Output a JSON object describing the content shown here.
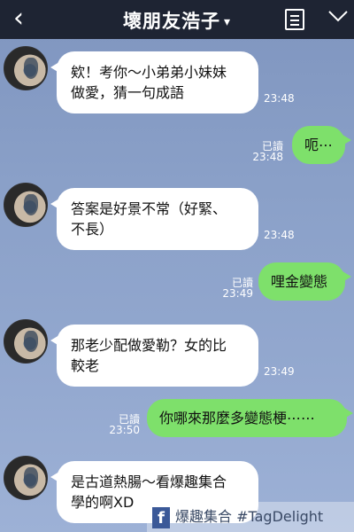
{
  "header": {
    "title": "壞朋友浩子",
    "caret": "▾",
    "back_icon": "back-chevron-icon",
    "menu_icon": "notes-menu-icon",
    "collapse_icon": "chevron-down-icon"
  },
  "messages": [
    {
      "side": "in",
      "lines": [
        "欸！考你～小弟弟小妹妹",
        "做愛，猜一句成語"
      ],
      "time": "23:48"
    },
    {
      "side": "out",
      "lines": [
        "呃⋯"
      ],
      "read": "已讀",
      "time": "23:48"
    },
    {
      "side": "in",
      "lines": [
        "答案是好景不常（好緊、",
        "不長）"
      ],
      "time": "23:48"
    },
    {
      "side": "out",
      "lines": [
        "哩金變態"
      ],
      "read": "已讀",
      "time": "23:49"
    },
    {
      "side": "in",
      "lines": [
        "那老少配做愛勒？女的比",
        "較老"
      ],
      "time": "23:49"
    },
    {
      "side": "out",
      "lines": [
        "你哪來那麼多變態梗⋯⋯"
      ],
      "read": "已讀",
      "time": "23:50"
    },
    {
      "side": "in",
      "lines": [
        "是古道熱腸～看爆趣集合",
        "學的啊XD"
      ],
      "time": ""
    }
  ],
  "watermark": {
    "text": "爆趣集合 #TagDelight",
    "icon": "facebook-icon"
  },
  "colors": {
    "header_bg": "#1e2433",
    "incoming_bubble": "#ffffff",
    "outgoing_bubble": "#7ee06b",
    "chat_bg": "#8aa0c8"
  }
}
